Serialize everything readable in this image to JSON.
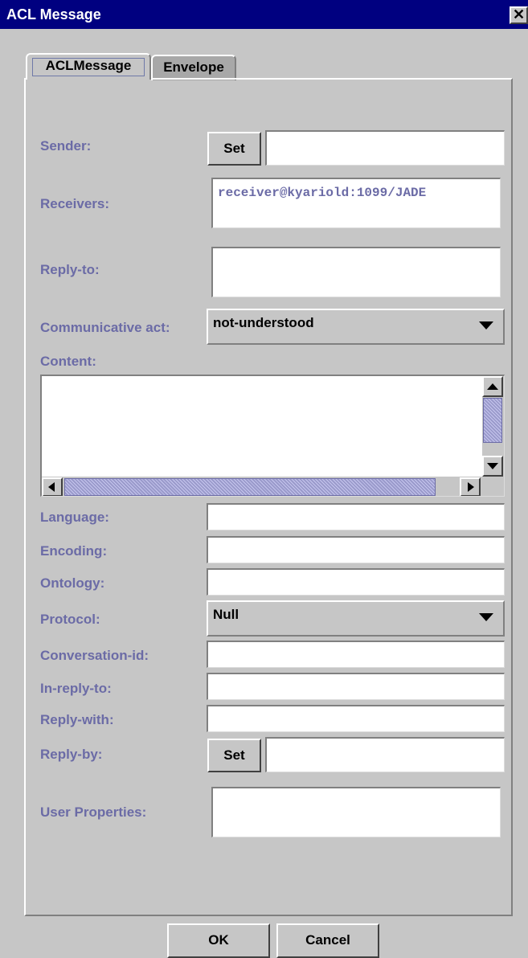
{
  "window": {
    "title": "ACL Message",
    "close_glyph": "✕"
  },
  "tabs": [
    {
      "label": "ACLMessage",
      "active": true
    },
    {
      "label": "Envelope",
      "active": false
    }
  ],
  "form": {
    "sender_label": "Sender:",
    "sender_set_label": "Set",
    "sender_value": "",
    "receivers_label": "Receivers:",
    "receivers_value": "receiver@kyariold:1099/JADE",
    "reply_to_label": "Reply-to:",
    "reply_to_value": "",
    "comm_act_label": "Communicative act:",
    "comm_act_value": "not-understood",
    "content_label": "Content:",
    "content_value": "",
    "language_label": "Language:",
    "language_value": "",
    "encoding_label": "Encoding:",
    "encoding_value": "",
    "ontology_label": "Ontology:",
    "ontology_value": "",
    "protocol_label": "Protocol:",
    "protocol_value": "Null",
    "conversation_id_label": "Conversation-id:",
    "conversation_id_value": "",
    "in_reply_to_label": "In-reply-to:",
    "in_reply_to_value": "",
    "reply_with_label": "Reply-with:",
    "reply_with_value": "",
    "reply_by_label": "Reply-by:",
    "reply_by_set_label": "Set",
    "reply_by_value": "",
    "user_properties_label": "User Properties:",
    "user_properties_value": ""
  },
  "buttons": {
    "ok_label": "OK",
    "cancel_label": "Cancel"
  },
  "colors": {
    "titlebar": "#000080",
    "label_text": "#6b6ba6",
    "window_bg": "#c6c6c6",
    "scroll_thumb": "#9a9acb"
  }
}
